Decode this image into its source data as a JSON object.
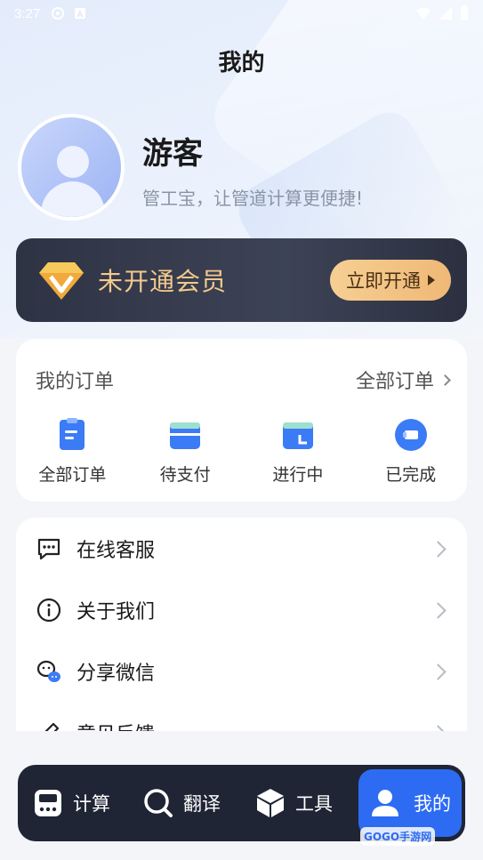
{
  "status_bar": {
    "time": "3:27"
  },
  "page": {
    "title": "我的"
  },
  "profile": {
    "name": "游客",
    "slogan": "管工宝，让管道计算更便捷!"
  },
  "vip": {
    "status": "未开通会员",
    "button": "立即开通"
  },
  "orders": {
    "title": "我的订单",
    "view_all": "全部订单",
    "items": [
      {
        "label": "全部订单",
        "icon": "all-orders-icon"
      },
      {
        "label": "待支付",
        "icon": "wallet-icon"
      },
      {
        "label": "进行中",
        "icon": "in-progress-icon"
      },
      {
        "label": "已完成",
        "icon": "completed-icon"
      }
    ]
  },
  "menu": {
    "items": [
      {
        "label": "在线客服",
        "icon": "chat-bubble-icon"
      },
      {
        "label": "关于我们",
        "icon": "info-icon"
      },
      {
        "label": "分享微信",
        "icon": "wechat-icon"
      },
      {
        "label": "意见反馈",
        "icon": "feedback-pencil-icon"
      }
    ]
  },
  "tabbar": {
    "tabs": [
      {
        "label": "计算",
        "icon": "calculator-icon"
      },
      {
        "label": "翻译",
        "icon": "search-icon"
      },
      {
        "label": "工具",
        "icon": "box-icon"
      },
      {
        "label": "我的",
        "icon": "user-icon"
      }
    ],
    "active_index": 3
  },
  "watermark": "GOGO手游网",
  "colors": {
    "accent": "#2d6bf2",
    "vip_gold": "#f3c98c",
    "tabbar_bg": "#1f2535"
  }
}
